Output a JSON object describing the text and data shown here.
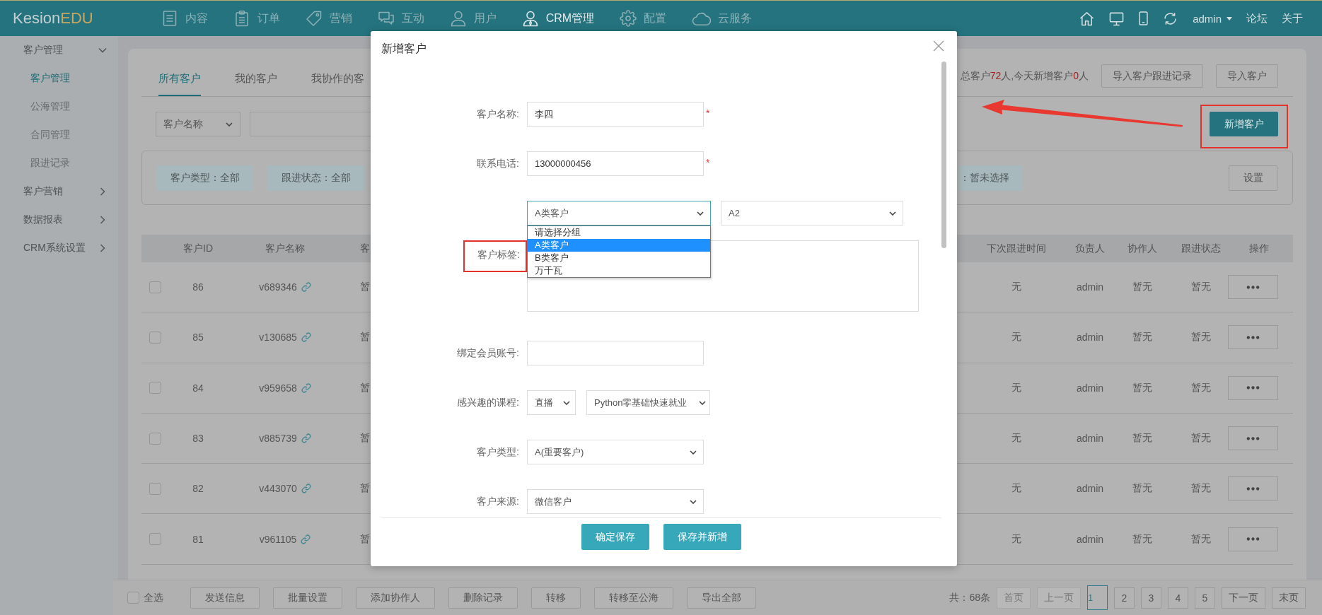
{
  "header": {
    "logo": {
      "main": "Kesion",
      "accent": "EDU"
    },
    "nav": [
      {
        "label": "内容",
        "selected": false
      },
      {
        "label": "订单",
        "selected": false
      },
      {
        "label": "营销",
        "selected": false
      },
      {
        "label": "互动",
        "selected": false
      },
      {
        "label": "用户",
        "selected": false
      },
      {
        "label": "CRM管理",
        "selected": true
      },
      {
        "label": "配置",
        "selected": false
      },
      {
        "label": "云服务",
        "selected": false
      }
    ],
    "user": "admin",
    "links": [
      "论坛",
      "关于"
    ]
  },
  "sidebar": {
    "items": [
      {
        "label": "客户管理",
        "expanded": true,
        "children": [
          {
            "label": "客户管理",
            "selected": true
          },
          {
            "label": "公海管理",
            "selected": false
          },
          {
            "label": "合同管理",
            "selected": false
          },
          {
            "label": "跟进记录",
            "selected": false
          }
        ]
      },
      {
        "label": "客户营销",
        "expanded": false
      },
      {
        "label": "数据报表",
        "expanded": false
      },
      {
        "label": "CRM系统设置",
        "expanded": false
      }
    ]
  },
  "main": {
    "tabs": [
      {
        "label": "所有客户",
        "selected": true
      },
      {
        "label": "我的客户",
        "selected": false
      },
      {
        "label": "我协作的客",
        "selected": false
      }
    ],
    "summary": [
      {
        "text": "总客户",
        "emphasis": false
      },
      {
        "text": "72",
        "emphasis": true
      },
      {
        "text": "人,今天新增客户",
        "emphasis": false
      },
      {
        "text": "0",
        "emphasis": true
      },
      {
        "text": "人",
        "emphasis": false
      }
    ],
    "top_buttons": [
      "导入客户跟进记录",
      "导入客户"
    ],
    "search": {
      "field": "客户名称"
    },
    "add_button": {
      "label": "新增客户",
      "highlighted": true
    },
    "filters": [
      "客户类型：全部",
      "跟进状态：全部",
      "：暂未选择"
    ],
    "settings_button": "设置",
    "table": {
      "columns": [
        "客户ID",
        "客户名称",
        "客",
        "下次跟进时间",
        "负责人",
        "协作人",
        "跟进状态",
        "操作"
      ],
      "rows": [
        {
          "checked": false,
          "id": "86",
          "name": "v689346",
          "column_3": "暂",
          "next_follow_up": "无",
          "owner": "admin",
          "collaborator": "暂无",
          "status": "暂无"
        },
        {
          "checked": false,
          "id": "85",
          "name": "v130685",
          "column_3": "暂",
          "next_follow_up": "无",
          "owner": "admin",
          "collaborator": "暂无",
          "status": "暂无"
        },
        {
          "checked": false,
          "id": "84",
          "name": "v959658",
          "column_3": "暂",
          "next_follow_up": "无",
          "owner": "admin",
          "collaborator": "暂无",
          "status": "暂无"
        },
        {
          "checked": false,
          "id": "83",
          "name": "v885739",
          "column_3": "暂",
          "next_follow_up": "无",
          "owner": "admin",
          "collaborator": "暂无",
          "status": "暂无"
        },
        {
          "checked": false,
          "id": "82",
          "name": "v443070",
          "column_3": "暂",
          "next_follow_up": "无",
          "owner": "admin",
          "collaborator": "暂无",
          "status": "暂无"
        },
        {
          "checked": false,
          "id": "81",
          "name": "v961105",
          "column_3": "暂",
          "next_follow_up": "无",
          "owner": "admin",
          "collaborator": "暂无",
          "status": "暂无"
        }
      ]
    }
  },
  "bulk_bar": {
    "select_all": {
      "label": "全选",
      "checked": false
    },
    "buttons": [
      "发送信息",
      "批量设置",
      "添加协作人",
      "删除记录",
      "转移",
      "转移至公海",
      "导出全部"
    ],
    "pagination": {
      "total": "共：68条",
      "first": {
        "label": "首页",
        "disabled": true
      },
      "prev": {
        "label": "上一页",
        "disabled": true
      },
      "pages": [
        {
          "label": "1",
          "selected": true
        },
        {
          "label": "2",
          "selected": false
        },
        {
          "label": "3",
          "selected": false
        },
        {
          "label": "4",
          "selected": false
        },
        {
          "label": "5",
          "selected": false
        }
      ],
      "next": {
        "label": "下一页",
        "disabled": false
      },
      "last": {
        "label": "末页",
        "disabled": false
      }
    }
  },
  "dialog": {
    "title": "新增客户",
    "required_mark": "*",
    "fields": [
      {
        "kind": "input",
        "label": "客户名称:",
        "highlighted": false,
        "value": "李四",
        "required": true
      },
      {
        "kind": "input",
        "label": "联系电话:",
        "highlighted": false,
        "value": "13000000456",
        "required": true
      },
      {
        "kind": "group-select",
        "selects": [
          {
            "value": "A类客户",
            "open": true,
            "options": [
              {
                "label": "请选择分组",
                "selected": false
              },
              {
                "label": "A类客户",
                "selected": true
              },
              {
                "label": "B类客户",
                "selected": false
              },
              {
                "label": "万千瓦",
                "selected": false
              }
            ]
          },
          {
            "value": "A2",
            "open": false
          }
        ]
      },
      {
        "kind": "textarea",
        "label": "客户标签:",
        "highlighted": true
      },
      {
        "kind": "input",
        "label": "绑定会员账号:",
        "highlighted": false,
        "required": false
      },
      {
        "kind": "course-select",
        "label": "感兴趣的课程:",
        "highlighted": false,
        "selects": [
          {
            "value": "直播",
            "open": false
          },
          {
            "value": "Python零基础快速就业",
            "open": false
          }
        ]
      },
      {
        "kind": "select",
        "label": "客户类型:",
        "highlighted": false,
        "value": "A(重要客户)"
      },
      {
        "kind": "select",
        "label": "客户来源:",
        "highlighted": false,
        "value": "微信客户"
      }
    ],
    "buttons": [
      "确定保存",
      "保存并新增"
    ]
  }
}
